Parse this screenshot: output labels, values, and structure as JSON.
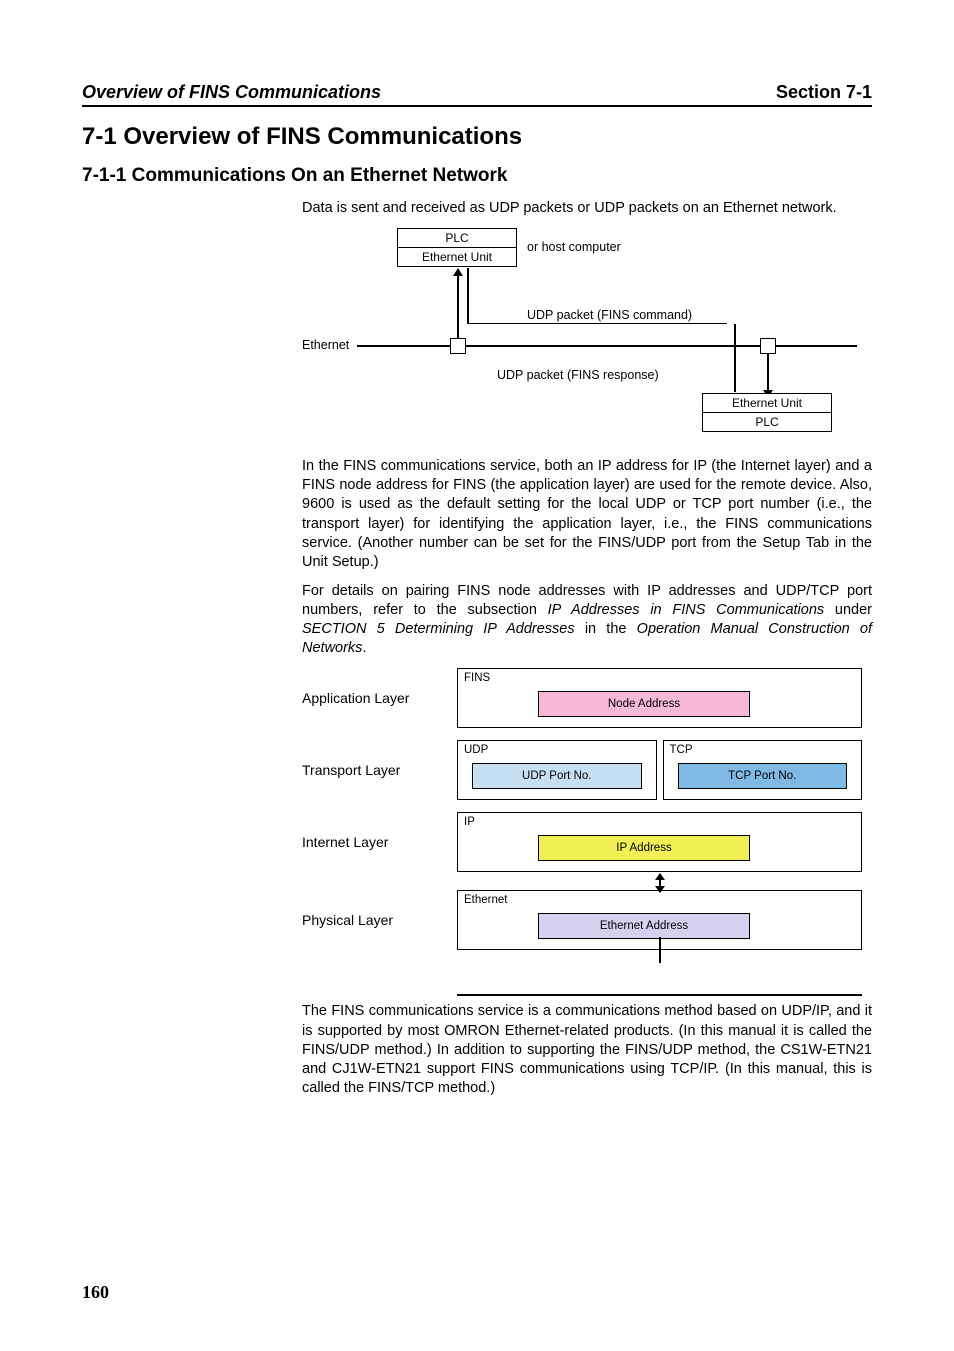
{
  "header": {
    "left": "Overview of FINS Communications",
    "right": "Section 7-1"
  },
  "headings": {
    "h1": "7-1   Overview of FINS Communications",
    "h2": "7-1-1   Communications On an Ethernet Network"
  },
  "paragraphs": {
    "p1": "Data is sent and received as UDP packets or UDP packets on an Ethernet network.",
    "p2": "In the FINS communications service, both an IP address for IP (the Internet layer) and a FINS node address for FINS (the application layer) are used for the remote device. Also, 9600 is used as the default setting for the local UDP or TCP port number (i.e., the transport layer) for identifying the application layer, i.e., the FINS communications service. (Another number can be set for the FINS/UDP port from the Setup Tab in the Unit Setup.)",
    "p3a": "For details on pairing FINS node addresses with IP addresses and UDP/TCP port numbers, refer to the subsection ",
    "p3b_ital": "IP Addresses in FINS Communications",
    "p3c": " under ",
    "p3d_ital": "SECTION 5 Determining IP Addresses",
    "p3e": " in the ",
    "p3f_ital": "Operation Manual Construction of Networks",
    "p3g": ".",
    "p4": "The FINS communications service is a communications method based on UDP/IP, and it is supported by most OMRON Ethernet-related products. (In this manual it is called the FINS/UDP method.) In addition to supporting the FINS/UDP method, the CS1W-ETN21 and CJ1W-ETN21 support FINS communications using TCP/IP. (In this manual, this is called the FINS/TCP method.)"
  },
  "fig1": {
    "plc_top": "PLC",
    "eth_unit_top": "Ethernet Unit",
    "host": "or host computer",
    "ethernet_label": "Ethernet",
    "cmd": "UDP packet (FINS command)",
    "resp": "UDP packet (FINS response)",
    "eth_unit_bot": "Ethernet Unit",
    "plc_bot": "PLC"
  },
  "fig2": {
    "layers": {
      "app": {
        "label": "Application Layer",
        "tag": "FINS",
        "box": "Node Address"
      },
      "trans": {
        "label": "Transport Layer",
        "udp_tag": "UDP",
        "udp_box": "UDP Port No.",
        "tcp_tag": "TCP",
        "tcp_box": "TCP Port No."
      },
      "inet": {
        "label": "Internet Layer",
        "tag": "IP",
        "box": "IP Address"
      },
      "phys": {
        "label": "Physical Layer",
        "tag": "Ethernet",
        "box": "Ethernet Address"
      }
    }
  },
  "page_number": "160"
}
